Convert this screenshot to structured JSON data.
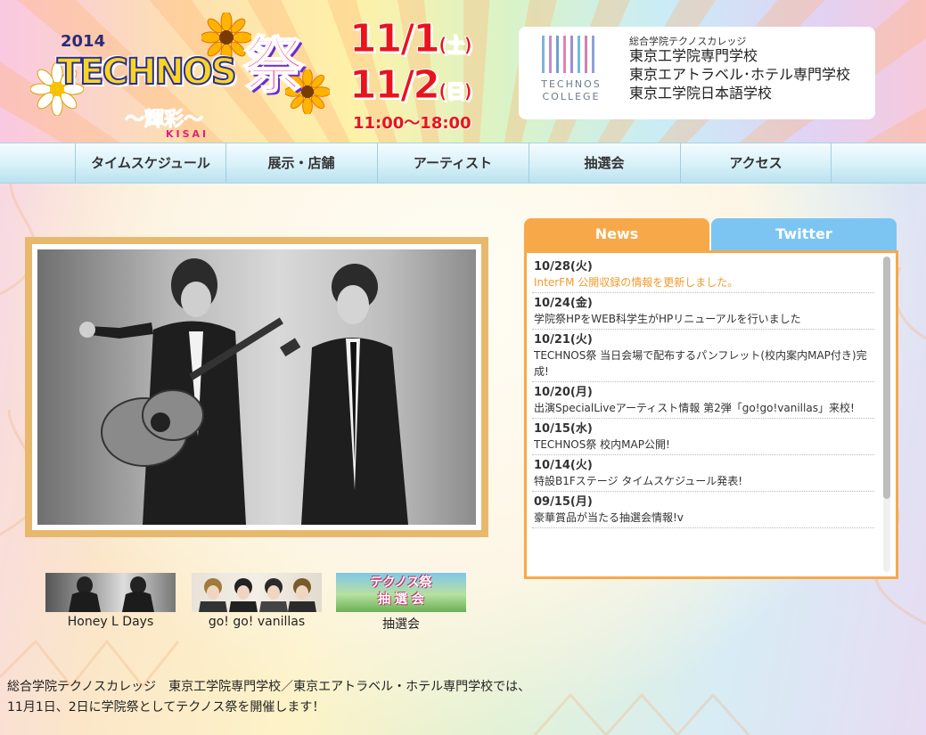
{
  "header": {
    "festival": {
      "year": "2014",
      "name": "TECHNOS",
      "matsuri": "祭",
      "subtitle": "〜輝彩〜",
      "subtitle_roman": "KISAI"
    },
    "dates": {
      "day1": "11/1",
      "day1_dow": "(土)",
      "day2": "11/2",
      "day2_dow": "(日)",
      "time": "11:00〜18:00"
    },
    "college": {
      "logo_text_line1": "TECHNOS",
      "logo_text_line2": "COLLEGE",
      "group": "総合学院テクノスカレッジ",
      "schools": [
        "東京工学院専門学校",
        "東京エアトラベル･ホテル専門学校",
        "東京工学院日本語学校"
      ],
      "bar_colors": [
        "#7fb3d8",
        "#c48cc8",
        "#6fa0d0",
        "#e083b0",
        "#9a8fd4",
        "#6dbde0",
        "#d07fb0",
        "#8fa0d8"
      ]
    }
  },
  "nav": {
    "items": [
      "タイムスケジュール",
      "展示・店舗",
      "アーティスト",
      "抽選会",
      "アクセス"
    ]
  },
  "thumbs": [
    {
      "caption": "Honey L Days"
    },
    {
      "caption": "go! go! vanillas"
    },
    {
      "caption": "抽選会",
      "banner_line1": "テクノス祭",
      "banner_line2": "抽 選 会"
    }
  ],
  "news_panel": {
    "tabs": [
      "News",
      "Twitter"
    ],
    "active_tab": "News",
    "colors": {
      "news_tab": "#f7a94a",
      "twitter_tab": "#7cc5f2",
      "highlight": "#f39a2b"
    },
    "items": [
      {
        "date": "10/28(火)",
        "text": "InterFM 公開収録の情報を更新しました。",
        "highlight": true
      },
      {
        "date": "10/24(金)",
        "text": "学院祭HPをWEB科学生がHPリニューアルを行いました",
        "highlight": false
      },
      {
        "date": "10/21(火)",
        "text": "TECHNOS祭 当日会場で配布するパンフレット(校内案内MAP付き)完成!",
        "highlight": false
      },
      {
        "date": "10/20(月)",
        "text": "出演SpecialLiveアーティスト情報 第2弾「go!go!vanillas」来校!",
        "highlight": false
      },
      {
        "date": "10/15(水)",
        "text": "TECHNOS祭 校内MAP公開!",
        "highlight": false
      },
      {
        "date": "10/14(火)",
        "text": "特設B1Fステージ タイムスケジュール発表!",
        "highlight": false
      },
      {
        "date": "09/15(月)",
        "text": "豪華賞品が当たる抽選会情報!v",
        "highlight": false
      }
    ]
  },
  "intro": {
    "line1": "総合学院テクノスカレッジ　東京工学院専門学校／東京エアトラベル・ホテル専門学校では、",
    "line2": "11月1日、2日に学院祭としてテクノス祭を開催します！"
  }
}
